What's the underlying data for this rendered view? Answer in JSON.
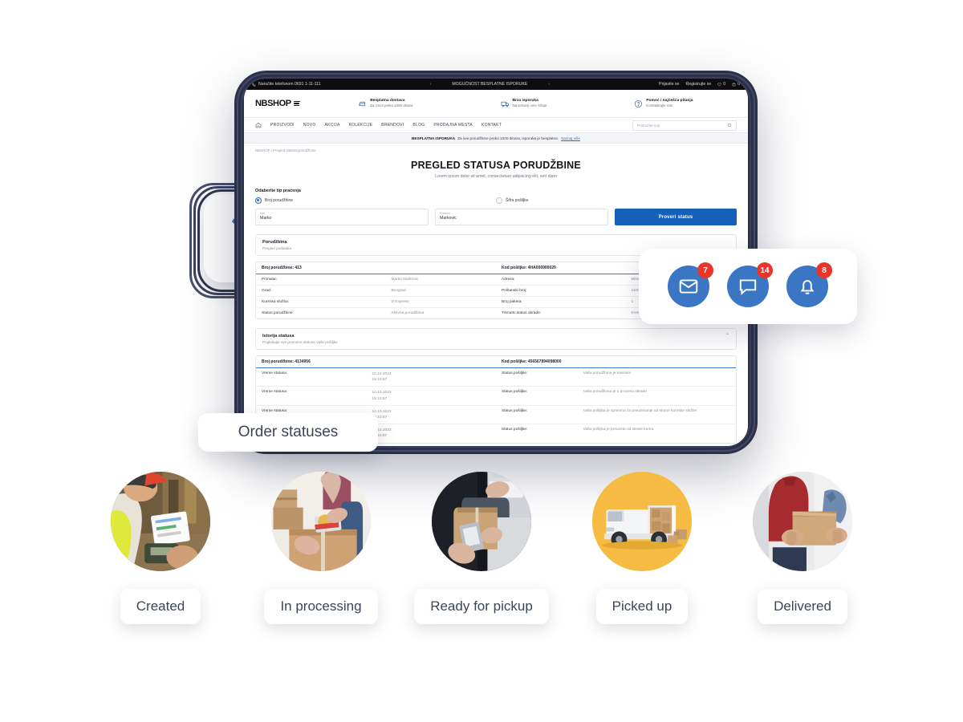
{
  "tablet": {
    "topbar": {
      "phone": "Naručite telefonom 0691 1-11-111",
      "center_note": "MOGUĆNOST BESPLATNE ISPORUKE",
      "prev_arrow": "‹",
      "next_arrow": "›",
      "login": "Prijavite se",
      "register": "Registrujte se",
      "wishlist_count": "0",
      "cart_count": "0"
    },
    "header": {
      "brand": "NBSHOP",
      "features": [
        {
          "title": "Besplatna dostava",
          "sub": "Za iznos preko 1000 dinara",
          "icon": "box-delivery-icon"
        },
        {
          "title": "Brza isporuka",
          "sub": "Na teritoriji cele Srbije",
          "icon": "truck-icon"
        },
        {
          "title": "Pomoć i najčešća pitanja",
          "sub": "Kontaktirajte nas",
          "icon": "help-icon"
        }
      ]
    },
    "nav": {
      "home_icon": "home-icon",
      "items": [
        "PROIZVODI",
        "NOVO",
        "AKCIJA",
        "KOLEKCIJE",
        "BRENDOVI",
        "BLOG",
        "PRODAJNA MESTA",
        "KONTAKT"
      ],
      "search_placeholder": "Pretražite sajt",
      "search_icon": "search-icon"
    },
    "promo": {
      "strong": "BESPLATNA ISPORUKA",
      "text": "Za sve porudžbine preko 1000 dinara, isporuka je besplatna.",
      "link": "Saznaj više"
    },
    "page": {
      "breadcrumb": "NBSHOP / Pregled statusa porudžbine",
      "title": "PREGLED STATUSA PORUDŽBINE",
      "subtitle": "Lorem ipsum dolor sit amet, consectetuer adipiscing elit, sed diam",
      "form": {
        "label": "Odaberite tip praćenja",
        "radio_order": "Broj porudžbine",
        "radio_shipment": "Šifra pošiljke",
        "first_name_label": "Ime",
        "first_name_value": "Marko",
        "last_name_label": "Prezime",
        "last_name_value": "Markovic",
        "submit": "Proveri status"
      },
      "order_panel": {
        "title": "Porudžbina",
        "desc": "Pregled podataka"
      },
      "order_table": {
        "header_left": "Broj porudžbine: 413",
        "header_right": "Kod pošiljke: 4HA000900020",
        "rows": [
          {
            "k1": "Primalac:",
            "v1": "Marko Markovic",
            "k2": "Adresa:",
            "v2": "Milutina Milankovica"
          },
          {
            "k1": "Grad:",
            "v1": "Beograd",
            "k2": "Poštanski broj:",
            "v2": "11000"
          },
          {
            "k1": "Kurirska služba:",
            "v1": "D Express",
            "k2": "Broj paketa:",
            "v2": "1"
          },
          {
            "k1": "Status porudžbine:",
            "v1": "Aktivna porudžbina",
            "k2": "Trenutni status obrade:",
            "v2": "Kreirana porudžbina"
          }
        ]
      },
      "history_panel": {
        "title": "Istorija statusa",
        "desc": "Pogledajte sve promene statusa Vaše pošiljke",
        "collapse_icon": "chevron-up-icon"
      },
      "history_table": {
        "header_left": "Broj porudžbine: 4134956",
        "header_right": "Kod pošiljke: 456567894098000",
        "rows": [
          {
            "k": "Vreme statusa:",
            "date": "10.10.2023",
            "time": "15:10:57",
            "sk": "Status pošiljke:",
            "sv": "Vaša porudžbina je kreirana"
          },
          {
            "k": "Vreme statusa:",
            "date": "10.10.2023",
            "time": "15:10:57",
            "sk": "Status pošiljke:",
            "sv": "Vaša porudžbina je u procesu obrade"
          },
          {
            "k": "Vreme statusa:",
            "date": "10.10.2023",
            "time": "15:10:57",
            "sk": "Status pošiljke:",
            "sv": "Vaša pošiljka je spremna za preuzimanje od strane kurirske službe"
          },
          {
            "k": "Vreme statusa:",
            "date": "10.10.2023",
            "time": "15:10:57",
            "sk": "Status pošiljke:",
            "sv": "Vaša pošiljka je preuzeta od strane kurira"
          }
        ]
      }
    }
  },
  "cart_card": {
    "icon": "shopping-cart-icon"
  },
  "notifications": [
    {
      "icon": "envelope-icon",
      "count": "7"
    },
    {
      "icon": "chat-bubble-icon",
      "count": "14"
    },
    {
      "icon": "bell-icon",
      "count": "8"
    }
  ],
  "order_statuses_pill": "Order statuses",
  "statuses": [
    {
      "label": "Created",
      "photo": "warehouse-scanning-photo"
    },
    {
      "label": "In processing",
      "photo": "taping-box-photo"
    },
    {
      "label": "Ready for pickup",
      "photo": "packages-ready-photo"
    },
    {
      "label": "Picked up",
      "photo": "delivery-van-photo"
    },
    {
      "label": "Delivered",
      "photo": "handover-box-photo"
    }
  ],
  "colors": {
    "brand_blue": "#3a76c4",
    "button_blue": "#1560b8",
    "badge_red": "#e8352c",
    "frame_dark": "#2b2f47",
    "text_navy": "#3d4458",
    "van_yellow": "#f6bb42"
  }
}
